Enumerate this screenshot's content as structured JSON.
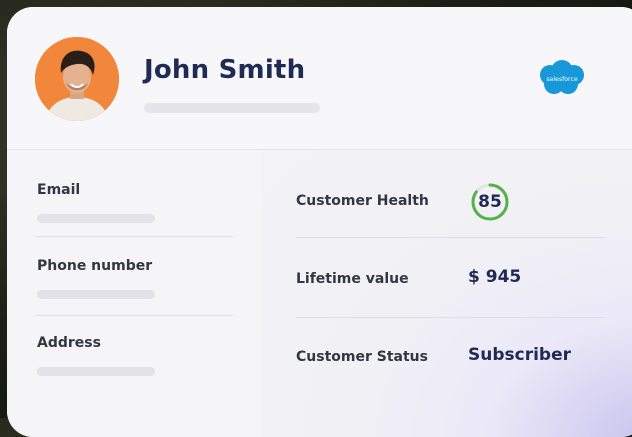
{
  "contact": {
    "name": "John Smith",
    "crm_logo_text": "salesforce",
    "crm_logo_icon": "salesforce-cloud-icon"
  },
  "fields": {
    "email_label": "Email",
    "phone_label": "Phone number",
    "address_label": "Address"
  },
  "metrics": {
    "health_label": "Customer Health",
    "health_score": "85",
    "health_fraction": 0.85,
    "lifetime_label": "Lifetime value",
    "lifetime_value": "$ 945",
    "status_label": "Customer Status",
    "status_value": "Subscriber"
  },
  "colors": {
    "accent_text": "#1f2a55",
    "health_ring": "#52b34a",
    "avatar_bg": "#f2863a",
    "salesforce_blue": "#1798d8"
  }
}
